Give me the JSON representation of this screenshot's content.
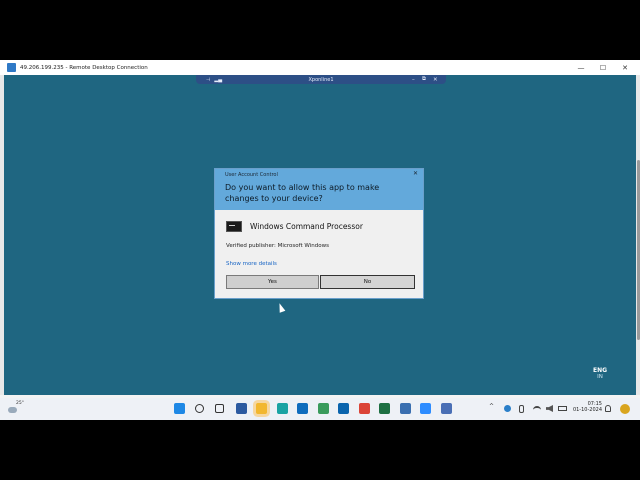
{
  "rdp_window": {
    "title": "49.206.199.235 - Remote Desktop Connection",
    "minimize": "—",
    "maximize": "☐",
    "close": "✕"
  },
  "connection_bar": {
    "host": "Xponline1",
    "pin": "⊣",
    "signal": "▂▄",
    "minimize": "–",
    "restore": "⧉",
    "close": "✕"
  },
  "uac": {
    "caption": "User Account Control",
    "close": "✕",
    "question": "Do you want to allow this app to make changes to your device?",
    "app_name": "Windows Command Processor",
    "publisher": "Verified publisher: Microsoft Windows",
    "more_details": "Show more details",
    "yes_label": "Yes",
    "no_label": "No"
  },
  "remote_lang": {
    "line1": "ENG",
    "line2": "IN"
  },
  "taskbar": {
    "weather_temp": "25°",
    "tray_chevron": "^",
    "clock_time": "07:15",
    "clock_date": "01-10-2024",
    "apps": [
      {
        "name": "start-icon",
        "color": "#1e88e5"
      },
      {
        "name": "search-icon",
        "color": "#333333"
      },
      {
        "name": "task-view-icon",
        "color": "#333333"
      },
      {
        "name": "store-icon",
        "color": "#2c5aa0"
      },
      {
        "name": "file-explorer-icon",
        "color": "#f2b72e"
      },
      {
        "name": "edge-icon",
        "color": "#1aa3a3"
      },
      {
        "name": "outlook-icon",
        "color": "#0f6cbd"
      },
      {
        "name": "edge-beta-icon",
        "color": "#3a9b5c"
      },
      {
        "name": "mail-icon",
        "color": "#0a64ad"
      },
      {
        "name": "chrome-icon",
        "color": "#db4437"
      },
      {
        "name": "excel-icon",
        "color": "#1d6f42"
      },
      {
        "name": "calculator-icon",
        "color": "#3a6fb0"
      },
      {
        "name": "zoom-icon",
        "color": "#2d8cff"
      },
      {
        "name": "remote-desktop-icon",
        "color": "#4a6fb5"
      }
    ]
  }
}
